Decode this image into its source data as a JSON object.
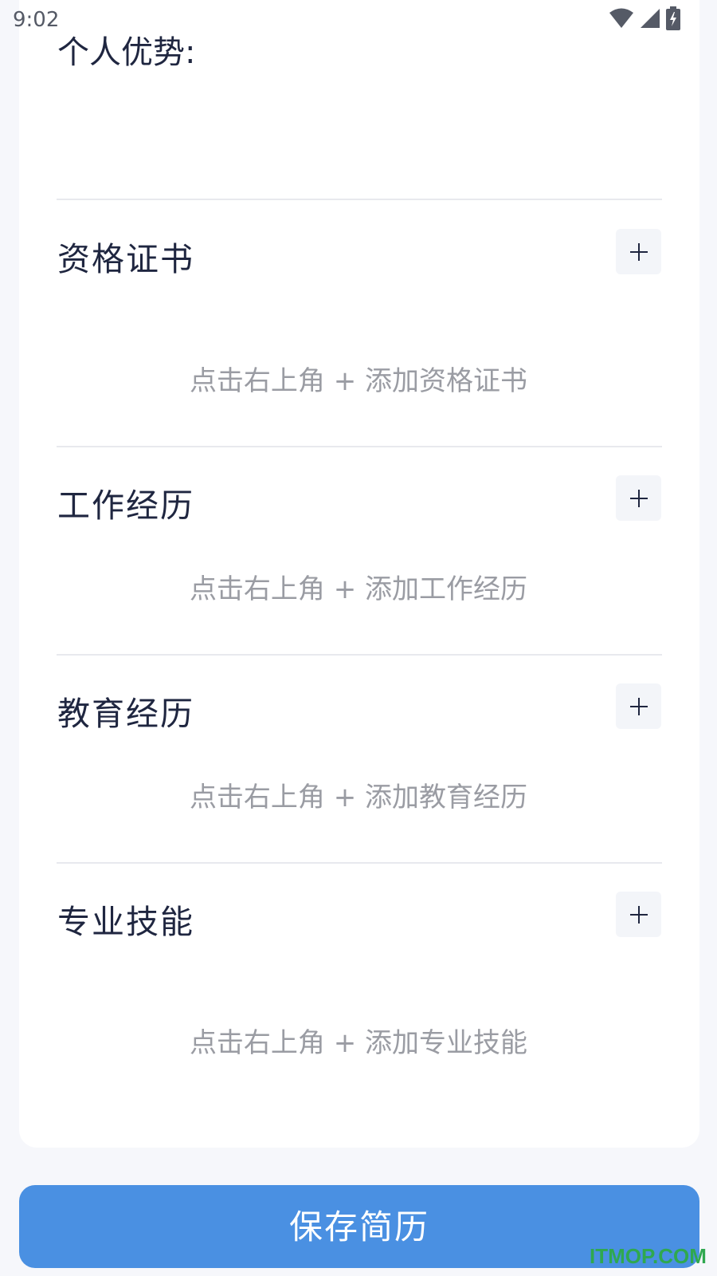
{
  "status_bar": {
    "time": "9:02",
    "icons": [
      "wifi-icon",
      "signal-icon",
      "battery-charging-icon"
    ]
  },
  "advantage": {
    "label": "个人优势:"
  },
  "sections": [
    {
      "title": "资格证书",
      "add_symbol": "+",
      "placeholder": "点击右上角 + 添加资格证书"
    },
    {
      "title": "工作经历",
      "add_symbol": "+",
      "placeholder": "点击右上角 + 添加工作经历"
    },
    {
      "title": "教育经历",
      "add_symbol": "+",
      "placeholder": "点击右上角 + 添加教育经历"
    },
    {
      "title": "专业技能",
      "add_symbol": "+",
      "placeholder": "点击右上角 + 添加专业技能"
    }
  ],
  "save_button": {
    "label": "保存简历"
  },
  "watermark": "ITMOP.COM",
  "colors": {
    "accent": "#4a90e2",
    "text": "#1f2640",
    "placeholder": "#9a9ca3",
    "watermark": "#2fa84f"
  }
}
